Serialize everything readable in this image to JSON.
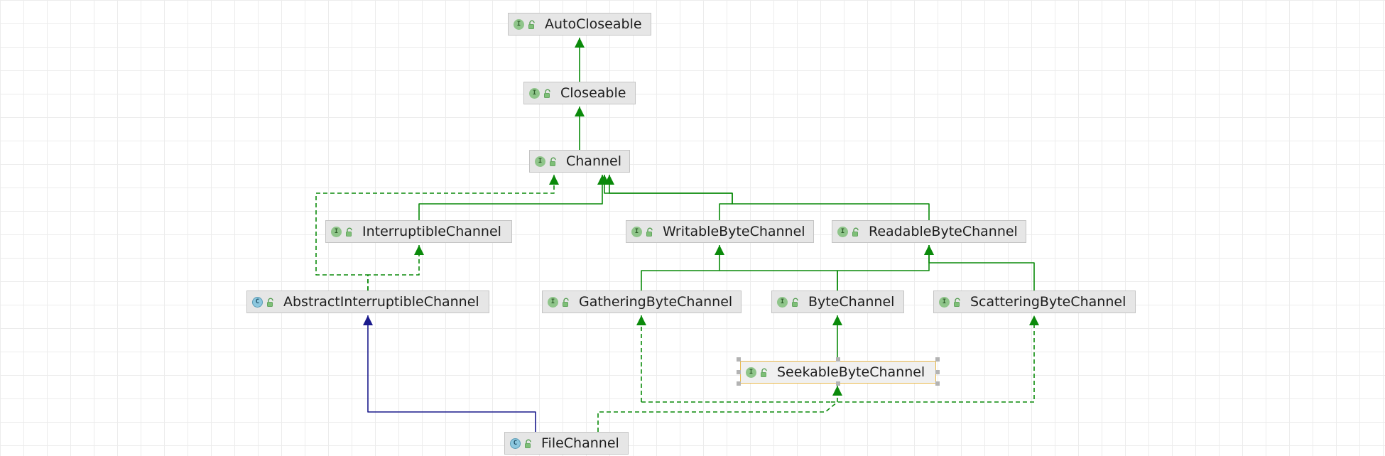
{
  "colors": {
    "implements": "#0a8a0a",
    "extends": "#1a1a8c",
    "selection": "#e8b84a"
  },
  "nodes": [
    {
      "id": "AutoCloseable",
      "label": "AutoCloseable",
      "kind": "interface",
      "icon": "interface-icon"
    },
    {
      "id": "Closeable",
      "label": "Closeable",
      "kind": "interface",
      "icon": "interface-icon"
    },
    {
      "id": "Channel",
      "label": "Channel",
      "kind": "interface",
      "icon": "interface-icon"
    },
    {
      "id": "InterruptibleChannel",
      "label": "InterruptibleChannel",
      "kind": "interface",
      "icon": "interface-icon"
    },
    {
      "id": "WritableByteChannel",
      "label": "WritableByteChannel",
      "kind": "interface",
      "icon": "interface-icon"
    },
    {
      "id": "ReadableByteChannel",
      "label": "ReadableByteChannel",
      "kind": "interface",
      "icon": "interface-icon"
    },
    {
      "id": "AbstractInterruptibleChannel",
      "label": "AbstractInterruptibleChannel",
      "kind": "class",
      "icon": "abstract-class-icon"
    },
    {
      "id": "GatheringByteChannel",
      "label": "GatheringByteChannel",
      "kind": "interface",
      "icon": "interface-icon"
    },
    {
      "id": "ByteChannel",
      "label": "ByteChannel",
      "kind": "interface",
      "icon": "interface-icon"
    },
    {
      "id": "ScatteringByteChannel",
      "label": "ScatteringByteChannel",
      "kind": "interface",
      "icon": "interface-icon"
    },
    {
      "id": "SeekableByteChannel",
      "label": "SeekableByteChannel",
      "kind": "interface",
      "icon": "interface-icon",
      "selected": true
    },
    {
      "id": "FileChannel",
      "label": "FileChannel",
      "kind": "class",
      "icon": "abstract-class-icon"
    }
  ],
  "edges": [
    {
      "from": "Closeable",
      "to": "AutoCloseable",
      "type": "extends-interface"
    },
    {
      "from": "Channel",
      "to": "Closeable",
      "type": "extends-interface"
    },
    {
      "from": "InterruptibleChannel",
      "to": "Channel",
      "type": "extends-interface"
    },
    {
      "from": "WritableByteChannel",
      "to": "Channel",
      "type": "extends-interface"
    },
    {
      "from": "ReadableByteChannel",
      "to": "Channel",
      "type": "extends-interface"
    },
    {
      "from": "AbstractInterruptibleChannel",
      "to": "Channel",
      "type": "implements"
    },
    {
      "from": "AbstractInterruptibleChannel",
      "to": "InterruptibleChannel",
      "type": "implements"
    },
    {
      "from": "GatheringByteChannel",
      "to": "WritableByteChannel",
      "type": "extends-interface"
    },
    {
      "from": "ByteChannel",
      "to": "WritableByteChannel",
      "type": "extends-interface"
    },
    {
      "from": "ByteChannel",
      "to": "ReadableByteChannel",
      "type": "extends-interface"
    },
    {
      "from": "ScatteringByteChannel",
      "to": "ReadableByteChannel",
      "type": "extends-interface"
    },
    {
      "from": "SeekableByteChannel",
      "to": "ByteChannel",
      "type": "extends-interface"
    },
    {
      "from": "FileChannel",
      "to": "AbstractInterruptibleChannel",
      "type": "extends-class"
    },
    {
      "from": "FileChannel",
      "to": "SeekableByteChannel",
      "type": "implements"
    },
    {
      "from": "FileChannel",
      "to": "GatheringByteChannel",
      "type": "implements"
    },
    {
      "from": "FileChannel",
      "to": "ScatteringByteChannel",
      "type": "implements"
    }
  ]
}
